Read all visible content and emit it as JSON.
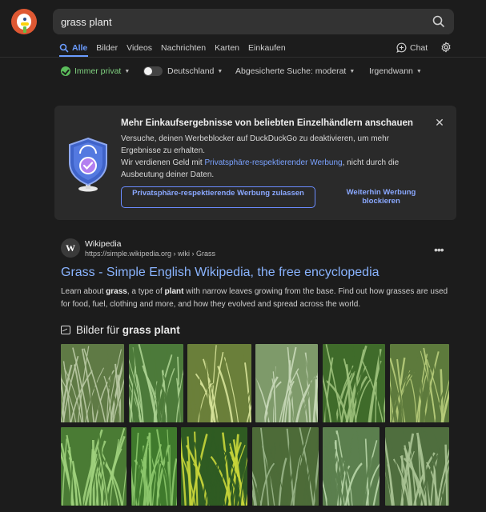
{
  "search": {
    "query": "grass plant"
  },
  "tabs": [
    {
      "label": "Alle",
      "active": true
    },
    {
      "label": "Bilder"
    },
    {
      "label": "Videos"
    },
    {
      "label": "Nachrichten"
    },
    {
      "label": "Karten"
    },
    {
      "label": "Einkaufen"
    }
  ],
  "chat_label": "Chat",
  "filters": {
    "privacy": "Immer privat",
    "region": "Deutschland",
    "safesearch": "Abgesicherte Suche: moderat",
    "time": "Irgendwann"
  },
  "promo": {
    "title": "Mehr Einkaufsergebnisse von beliebten Einzelhändlern anschauen",
    "line1": "Versuche, deinen Werbeblocker auf DuckDuckGo zu deaktivieren, um mehr Ergebnisse zu erhalten.",
    "line2_prefix": "Wir verdienen Geld mit ",
    "line2_link": "Privatsphäre-respektierender Werbung",
    "line2_suffix": ", nicht durch die Ausbeutung deiner Daten.",
    "allow_button": "Privatsphäre-respektierende Werbung zulassen",
    "block_button": "Weiterhin Werbung blockieren"
  },
  "result": {
    "favicon_letter": "W",
    "site_name": "Wikipedia",
    "url": "https://simple.wikipedia.org › wiki › Grass",
    "title": "Grass - Simple English Wikipedia, the free encyclopedia",
    "snippet_1": "Learn about ",
    "snippet_b1": "grass",
    "snippet_2": ", a type of ",
    "snippet_b2": "plant",
    "snippet_3": " with narrow leaves growing from the base. Find out how grasses are used for food, fuel, clothing and more, and how they evolved and spread across the world."
  },
  "images": {
    "header_prefix": "Bilder für ",
    "header_query": "grass plant"
  },
  "colors": {
    "accent": "#6b9cff",
    "link": "#8ab4ff",
    "privacy_green": "#5bbd5b",
    "logo_orange": "#de5833"
  }
}
